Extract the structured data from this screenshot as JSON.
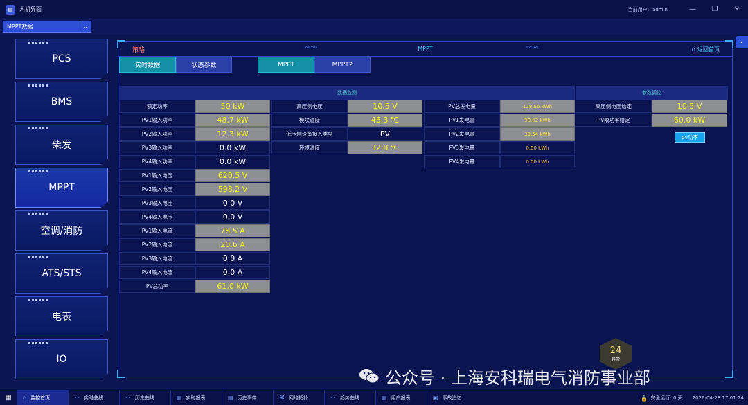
{
  "app": {
    "title": "人机界面",
    "icon": "hmi-app-icon",
    "user_label": "当前用户:",
    "user_name": "admin"
  },
  "toolbar": {
    "dropdown_value": "MPPT数据"
  },
  "sidebar": {
    "items": [
      {
        "label": "PCS",
        "active": false
      },
      {
        "label": "BMS",
        "active": false
      },
      {
        "label": "柴发",
        "active": false
      },
      {
        "label": "MPPT",
        "active": true
      },
      {
        "label": "空调/消防",
        "active": false
      },
      {
        "label": "ATS/STS",
        "active": false
      },
      {
        "label": "电表",
        "active": false
      },
      {
        "label": "IO",
        "active": false
      }
    ]
  },
  "header": {
    "strategy": "策略",
    "title": "MPPT",
    "arrows_left": "»»»»",
    "arrows_right": "««««",
    "home_label": "返回首页"
  },
  "tabs": {
    "realtime": "实时数据",
    "status": "状态参数",
    "mppt": "MPPT",
    "mppt2": "MPPT2"
  },
  "sections": {
    "monitor": "数据监测",
    "param": "参数调控"
  },
  "col1": [
    {
      "label": "额定功率",
      "value": "50 kW",
      "style": "gray"
    },
    {
      "label": "PV1输入功率",
      "value": "48.7 kW",
      "style": "gray"
    },
    {
      "label": "PV2输入功率",
      "value": "12.3 kW",
      "style": "gray"
    },
    {
      "label": "PV3输入功率",
      "value": "0.0 kW",
      "style": "dark"
    },
    {
      "label": "PV4输入功率",
      "value": "0.0 kW",
      "style": "dark"
    },
    {
      "label": "PV1输入电压",
      "value": "620.5 V",
      "style": "gray"
    },
    {
      "label": "PV2输入电压",
      "value": "598.2 V",
      "style": "gray"
    },
    {
      "label": "PV3输入电压",
      "value": "0.0 V",
      "style": "dark"
    },
    {
      "label": "PV4输入电压",
      "value": "0.0 V",
      "style": "dark"
    },
    {
      "label": "PV1输入电流",
      "value": "78.5 A",
      "style": "gray"
    },
    {
      "label": "PV2输入电流",
      "value": "20.6 A",
      "style": "gray"
    },
    {
      "label": "PV3输入电流",
      "value": "0.0 A",
      "style": "dark"
    },
    {
      "label": "PV4输入电流",
      "value": "0.0 A",
      "style": "dark"
    },
    {
      "label": "PV总功率",
      "value": "61.0 kW",
      "style": "gray"
    }
  ],
  "col2": [
    {
      "label": "高压侧电压",
      "value": "10.5 V",
      "style": "gray"
    },
    {
      "label": "模块温度",
      "value": "45.3 ℃",
      "style": "gray"
    },
    {
      "label": "低压侧设备接入类型",
      "value": "PV",
      "style": "dark"
    },
    {
      "label": "环境温度",
      "value": "32.8 ℃",
      "style": "gray"
    }
  ],
  "col3": [
    {
      "label": "PV总发电量",
      "value": "128.56 kWh",
      "style": "gray"
    },
    {
      "label": "PV1发电量",
      "value": "98.02 kWh",
      "style": "gray"
    },
    {
      "label": "PV2发电量",
      "value": "30.54 kWh",
      "style": "gray"
    },
    {
      "label": "PV3发电量",
      "value": "0.00 kWh",
      "style": "dark"
    },
    {
      "label": "PV4发电量",
      "value": "0.00 kWh",
      "style": "dark"
    }
  ],
  "col4": [
    {
      "label": "高压侧电压给定",
      "value": "10.5 V",
      "style": "gray"
    },
    {
      "label": "PV限功率给定",
      "value": "60.0 kW",
      "style": "gray"
    }
  ],
  "pv_button": "pv功率",
  "badge": {
    "num": "24",
    "text": "异常"
  },
  "watermark": "公众号 · 上海安科瑞电气消防事业部",
  "taskbar": {
    "items": [
      {
        "label": "监控首页",
        "icon": "home-icon",
        "active": true
      },
      {
        "label": "实时曲线",
        "icon": "chart-line-icon",
        "active": false
      },
      {
        "label": "历史曲线",
        "icon": "history-chart-icon",
        "active": false
      },
      {
        "label": "实时报表",
        "icon": "report-icon",
        "active": false
      },
      {
        "label": "历史事件",
        "icon": "event-icon",
        "active": false
      },
      {
        "label": "网络拓扑",
        "icon": "network-icon",
        "active": false
      },
      {
        "label": "趋势曲线",
        "icon": "trend-icon",
        "active": false
      },
      {
        "label": "用户报表",
        "icon": "user-report-icon",
        "active": false
      },
      {
        "label": "事故追忆",
        "icon": "incident-icon",
        "active": false
      }
    ],
    "safety": "安全运行: 0 天",
    "datetime": "2026-04-28 17:01:24"
  }
}
